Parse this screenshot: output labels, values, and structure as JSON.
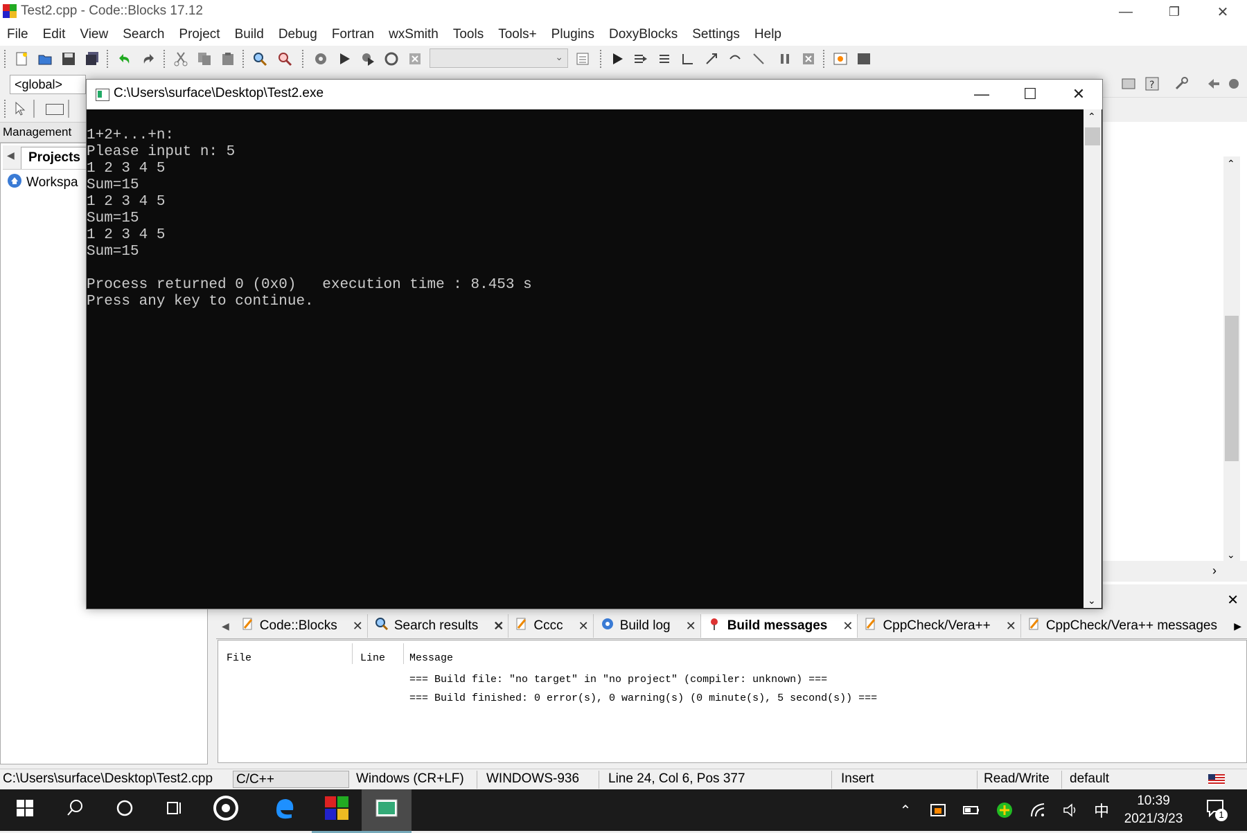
{
  "window": {
    "title": "Test2.cpp - Code::Blocks 17.12",
    "minimize_icon": "minimize-icon",
    "restore_icon": "restore-icon",
    "close_icon": "close-icon"
  },
  "menu": [
    "File",
    "Edit",
    "View",
    "Search",
    "Project",
    "Build",
    "Debug",
    "Fortran",
    "wxSmith",
    "Tools",
    "Tools+",
    "Plugins",
    "DoxyBlocks",
    "Settings",
    "Help"
  ],
  "toolbar": {
    "global_scope": "<global>"
  },
  "management": {
    "title": "Management",
    "tab": "Projects",
    "workspace": "Workspa"
  },
  "console": {
    "title": "C:\\Users\\surface\\Desktop\\Test2.exe",
    "lines": [
      "1+2+...+n:",
      "Please input n: 5",
      "1 2 3 4 5",
      "Sum=15",
      "1 2 3 4 5",
      "Sum=15",
      "1 2 3 4 5",
      "Sum=15",
      "",
      "Process returned 0 (0x0)   execution time : 8.453 s",
      "Press any key to continue."
    ]
  },
  "logs": {
    "tabs": [
      {
        "label": "Code::Blocks",
        "icon": "pencil-icon"
      },
      {
        "label": "Search results",
        "icon": "magnifier-icon"
      },
      {
        "label": "Cccc",
        "icon": "pencil-icon"
      },
      {
        "label": "Build log",
        "icon": "gear-icon"
      },
      {
        "label": "Build messages",
        "icon": "pin-icon",
        "active": true
      },
      {
        "label": "CppCheck/Vera++",
        "icon": "pencil-icon"
      },
      {
        "label": "CppCheck/Vera++ messages",
        "icon": "pencil-icon"
      }
    ],
    "columns": {
      "file": "File",
      "line": "Line",
      "message": "Message"
    },
    "messages": [
      "=== Build file: \"no target\" in \"no project\" (compiler: unknown) ===",
      "=== Build finished: 0 error(s), 0 warning(s) (0 minute(s), 5 second(s)) ==="
    ]
  },
  "status": {
    "path": "C:\\Users\\surface\\Desktop\\Test2.cpp",
    "language": "C/C++",
    "eol": "Windows (CR+LF)",
    "encoding": "WINDOWS-936",
    "position": "Line 24, Col 6, Pos 377",
    "mode": "Insert",
    "access": "Read/Write",
    "theme": "default"
  },
  "taskbar": {
    "time": "10:39",
    "date": "2021/3/23",
    "ime": "中",
    "notification_count": "1"
  }
}
